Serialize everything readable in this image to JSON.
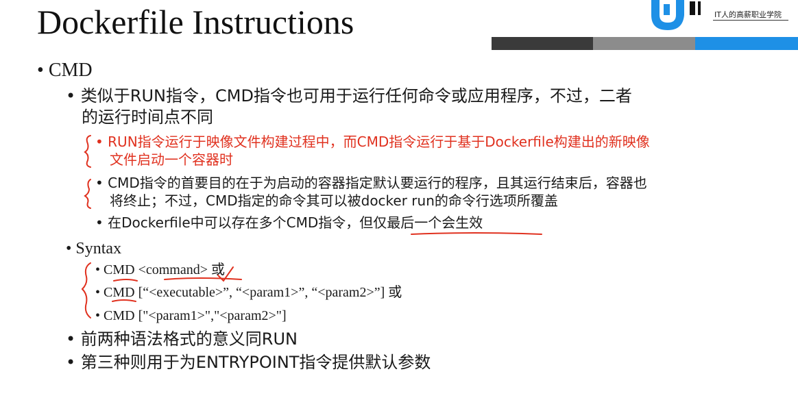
{
  "slide": {
    "title": "Dockerfile Instructions",
    "logo_tagline": "IT人的高薪职业学院",
    "colors": {
      "accent_blue": "#1e90e6",
      "red": "#e0311f",
      "bar_dark": "#3a3a3a",
      "bar_gray": "#8c8c8c"
    }
  },
  "content": {
    "cmd_heading": "CMD",
    "bullet_symbol": "•",
    "point1_line1": "类似于RUN指令，CMD指令也可用于运行任何命令或应用程序，不过，二者",
    "point1_line2": "的运行时间点不同",
    "sub1_line1": "RUN指令运行于映像文件构建过程中，而CMD指令运行于基于Dockerfile构建出的新映像",
    "sub1_line2": "文件启动一个容器时",
    "sub2_line1": "CMD指令的首要目的在于为启动的容器指定默认要运行的程序，且其运行结束后，容器也",
    "sub2_line2": "将终止；不过，CMD指定的命令其可以被docker run的命令行选项所覆盖",
    "sub3": "在Dockerfile中可以存在多个CMD指令，但仅最后一个会生效",
    "syntax_heading": "Syntax",
    "syntax1": "CMD <command> 或",
    "syntax2": "CMD [“<executable>”, “<param1>”, “<param2>”] 或",
    "syntax3": "CMD [\"<param1>\",\"<param2>\"]",
    "point2": "前两种语法格式的意义同RUN",
    "point3": "第三种则用于为ENTRYPOINT指令提供默认参数"
  }
}
